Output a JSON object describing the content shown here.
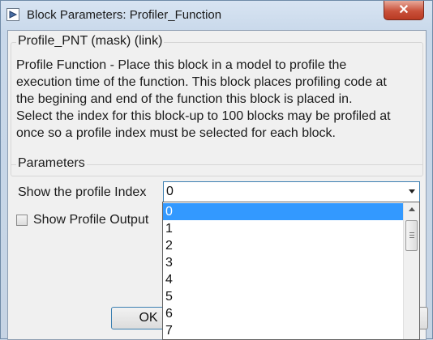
{
  "window": {
    "title": "Block Parameters: Profiler_Function",
    "close_label": "✕"
  },
  "mask": {
    "title": "Profile_PNT (mask) (link)",
    "description_lines": [
      "Profile Function - Place this block in a model to profile the",
      "execution time of the function.  This block places profiling code at",
      "the begining and end of the function this block is placed in.",
      "Select the index for this block-up to 100 blocks may be profiled at",
      "once so a profile index must be selected for each block."
    ]
  },
  "parameters": {
    "title": "Parameters",
    "profile_index_label": "Show the profile Index",
    "profile_index_value": "0",
    "show_output_label": "Show Profile Output",
    "show_output_checked": false
  },
  "dropdown": {
    "options": [
      "0",
      "1",
      "2",
      "3",
      "4",
      "5",
      "6",
      "7"
    ],
    "selected": "0"
  },
  "buttons": {
    "ok_label": "OK"
  },
  "icons": {
    "app": "simulink-block-icon",
    "close": "close-icon",
    "select_arrow": "chevron-down-icon",
    "scroll_up": "scroll-up-arrow-icon"
  }
}
